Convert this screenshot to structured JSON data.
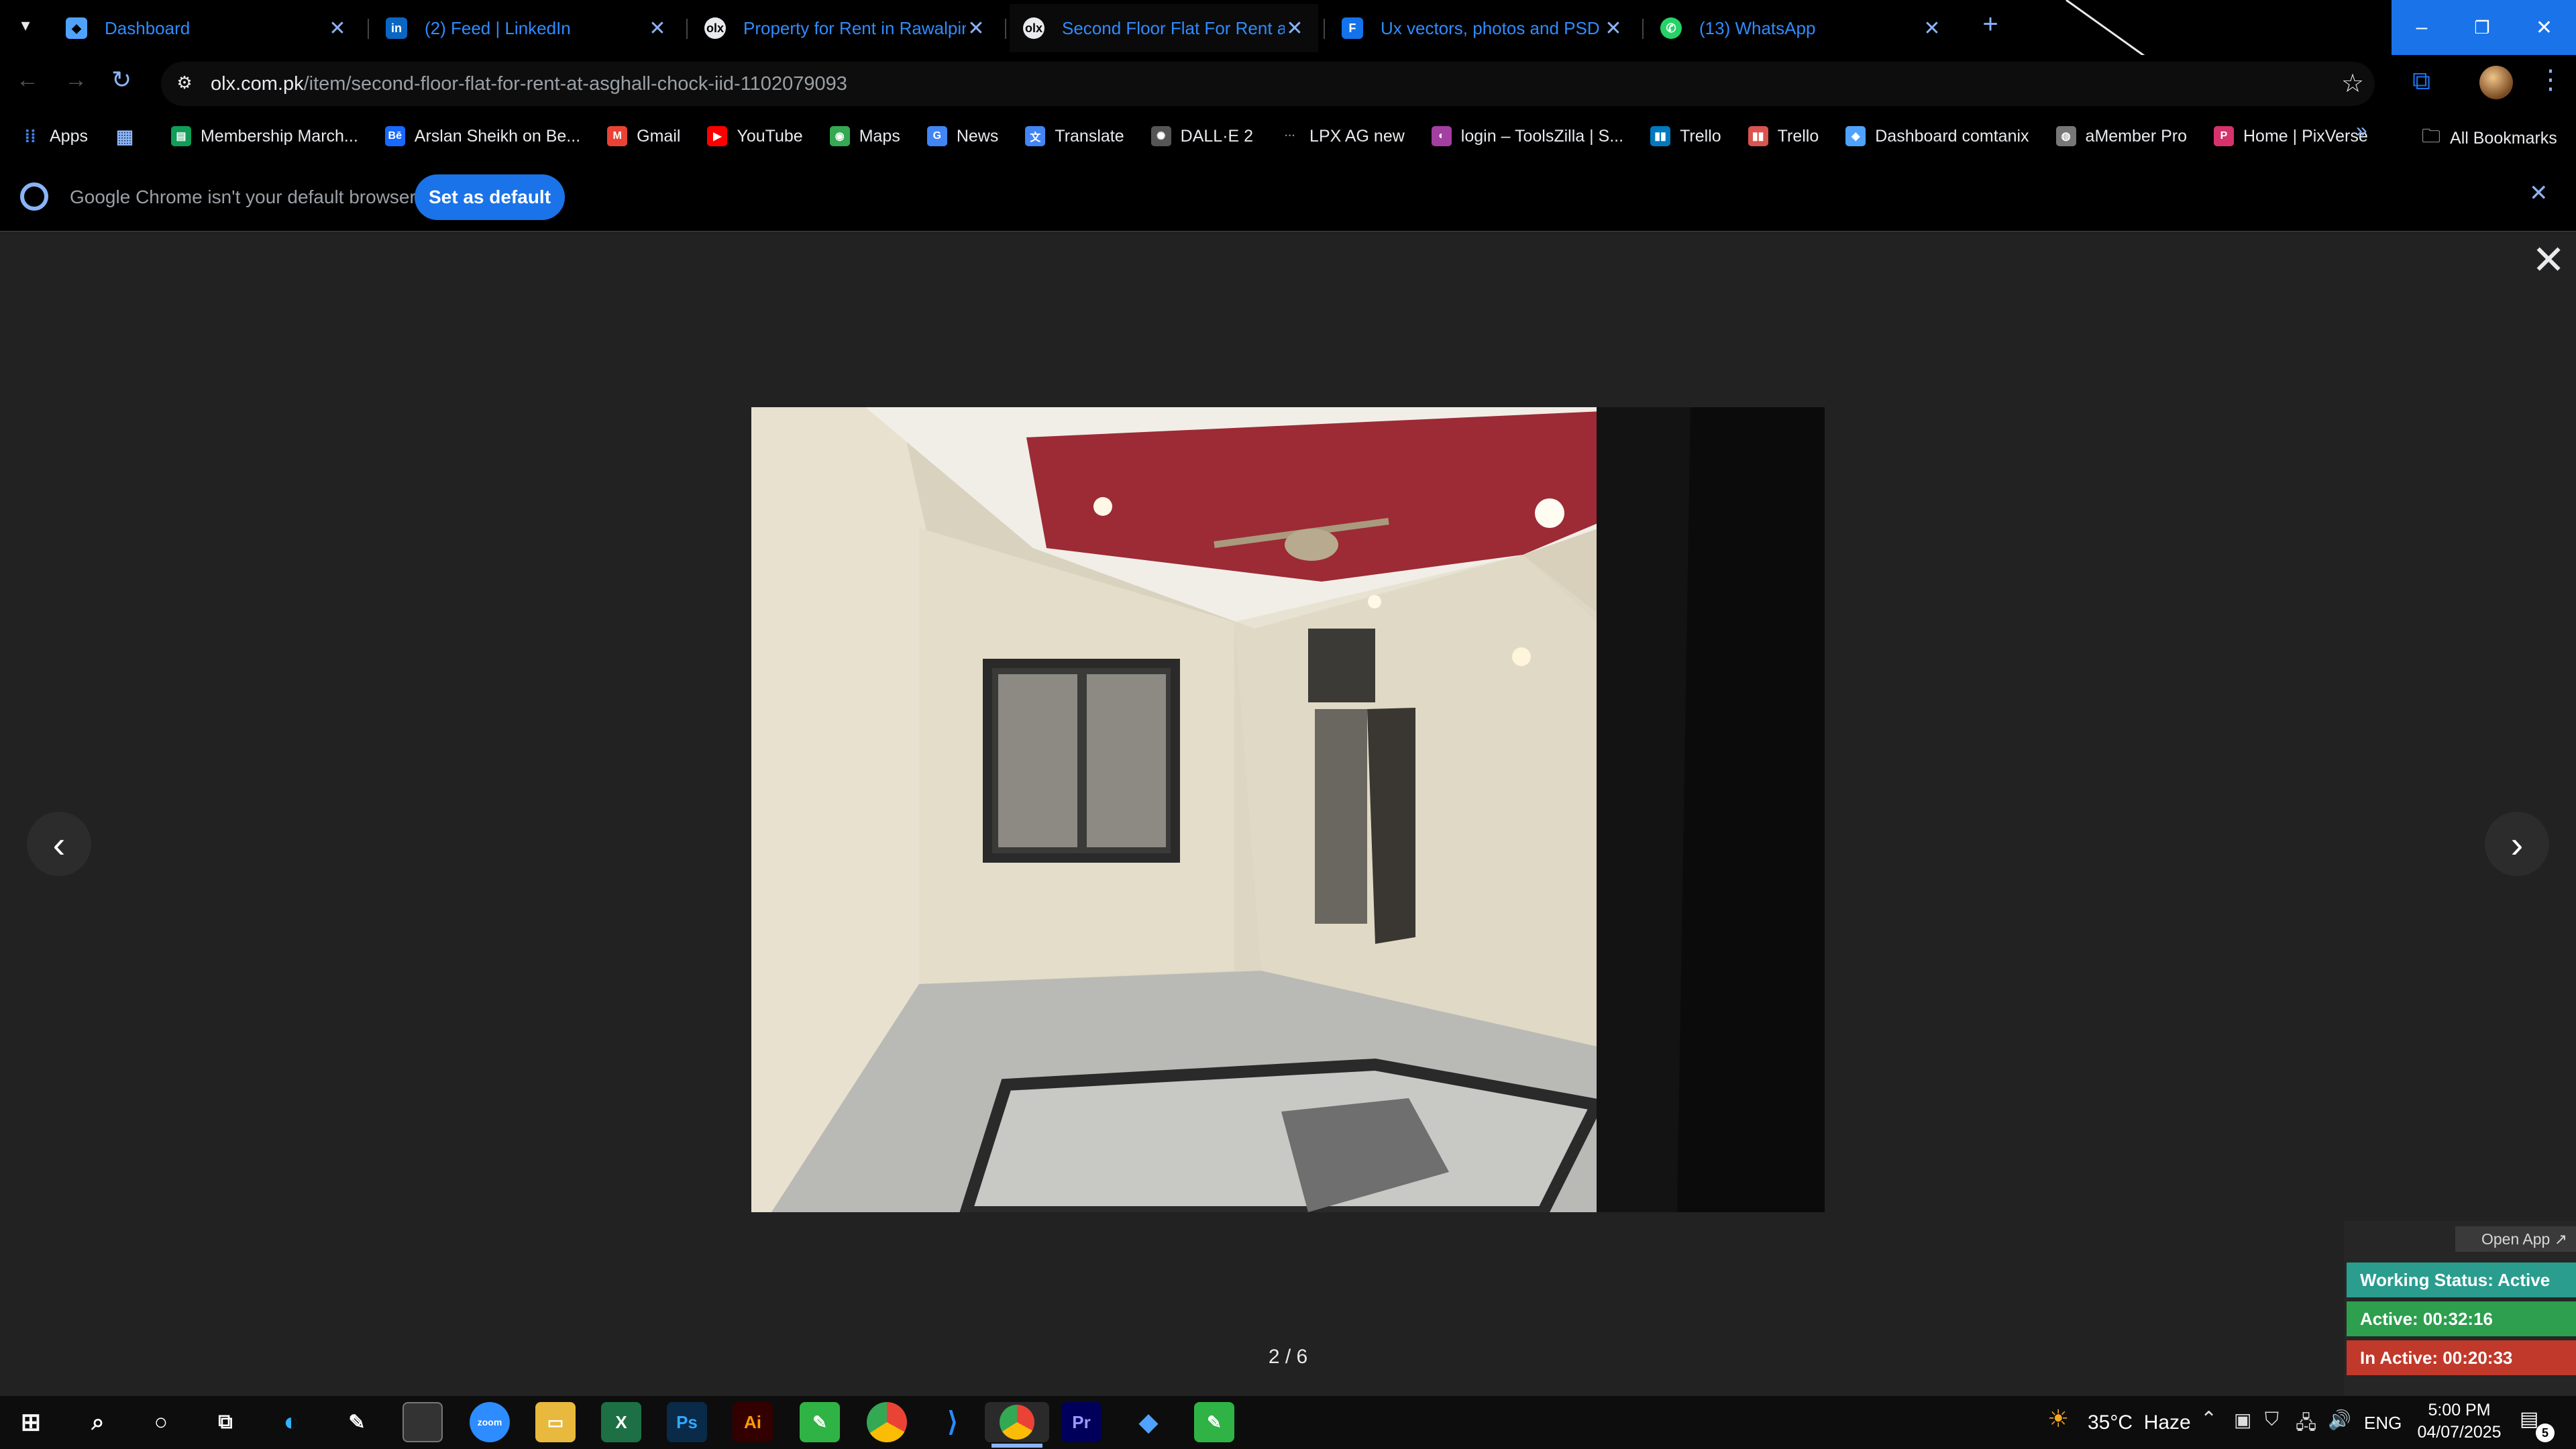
{
  "tabs": [
    {
      "title": "Dashboard",
      "icon": "dashboard-favicon",
      "color": "#4fa3ff"
    },
    {
      "title": "(2) Feed | LinkedIn",
      "icon": "linkedin-favicon",
      "color": "#0a66c2"
    },
    {
      "title": "Property for Rent in Rawalpindi",
      "icon": "olx-favicon",
      "color": "#e8eaed"
    },
    {
      "title": "Second Floor Flat For Rent at A",
      "icon": "olx-favicon",
      "color": "#e8eaed"
    },
    {
      "title": "Ux vectors, photos and PSD file",
      "icon": "freepik-favicon",
      "color": "#1273eb"
    },
    {
      "title": "(13) WhatsApp",
      "icon": "whatsapp-favicon",
      "color": "#25d366"
    }
  ],
  "address": {
    "domain": "olx.com.pk",
    "path": "/item/second-floor-flat-for-rent-at-asghall-chock-iid-1102079093"
  },
  "bookmarks": [
    {
      "label": "Apps",
      "icon": "apps-grid-icon",
      "color": "#4285f4"
    },
    {
      "label": "",
      "icon": "tab-groups-icon",
      "color": "#8ab4f8"
    },
    {
      "label": "Membership March...",
      "icon": "sheets-icon",
      "color": "#0f9d58"
    },
    {
      "label": "Arslan Sheikh on Be...",
      "icon": "behance-icon",
      "color": "#1769ff"
    },
    {
      "label": "Gmail",
      "icon": "gmail-icon",
      "color": "#ea4335"
    },
    {
      "label": "YouTube",
      "icon": "youtube-icon",
      "color": "#ff0000"
    },
    {
      "label": "Maps",
      "icon": "maps-icon",
      "color": "#34a853"
    },
    {
      "label": "News",
      "icon": "news-icon",
      "color": "#4285f4"
    },
    {
      "label": "Translate",
      "icon": "translate-icon",
      "color": "#4285f4"
    },
    {
      "label": "DALL·E 2",
      "icon": "openai-icon",
      "color": "#888888"
    },
    {
      "label": "LPX AG new",
      "icon": "dots-icon",
      "color": "#666666"
    },
    {
      "label": "login – ToolsZilla | S...",
      "icon": "toolszilla-icon",
      "color": "#a33fa0"
    },
    {
      "label": "Trello",
      "icon": "trello-icon",
      "color": "#0079bf"
    },
    {
      "label": "Trello",
      "icon": "trello-icon",
      "color": "#d9534f"
    },
    {
      "label": "Dashboard comtanix",
      "icon": "dashboard-icon",
      "color": "#4fa3ff"
    },
    {
      "label": "aMember Pro",
      "icon": "amember-icon",
      "color": "#999999"
    },
    {
      "label": "Home | PixVerse",
      "icon": "pixverse-icon",
      "color": "#d6336c"
    }
  ],
  "all_bookmarks": "All Bookmarks",
  "infobar": {
    "message": "Google Chrome isn't your default browser",
    "button": "Set as default"
  },
  "viewer": {
    "counter": "2 / 6"
  },
  "widget": {
    "open_app": "Open App ↗",
    "status": "Working Status: Active",
    "active": "Active: 00:32:16",
    "inactive": "In Active: 00:20:33",
    "colors": {
      "status": "#2a9d8f",
      "active": "#2e9e4f",
      "inactive": "#c0392b"
    }
  },
  "taskbar": {
    "apps": [
      "windows-start",
      "search",
      "cortana",
      "task-view",
      "edge",
      "pen-tool",
      "terminal",
      "zoom",
      "file-explorer",
      "excel",
      "photoshop",
      "illustrator",
      "green-app",
      "chrome",
      "vscode",
      "chrome-active",
      "premiere",
      "dashboard-app",
      "green-app-2"
    ],
    "weather": "35°C  Haze",
    "lang": "ENG",
    "time": "5:00 PM",
    "date": "04/07/2025",
    "notifications": "5"
  }
}
